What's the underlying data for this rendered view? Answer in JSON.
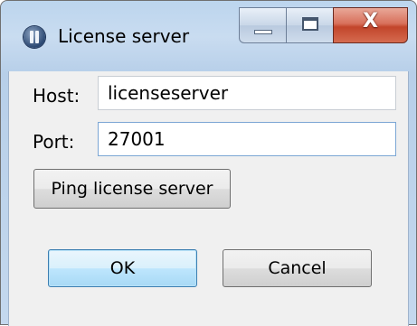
{
  "window": {
    "title": "License server",
    "icon": "app-logo-icon",
    "controls": {
      "minimize": "minimize-icon",
      "maximize": "maximize-icon",
      "close_glyph": "X"
    }
  },
  "form": {
    "host_label": "Host:",
    "host_value": "licenseserver",
    "port_label": "Port:",
    "port_value": "27001"
  },
  "buttons": {
    "ping": "Ping license server",
    "ok": "OK",
    "cancel": "Cancel"
  }
}
